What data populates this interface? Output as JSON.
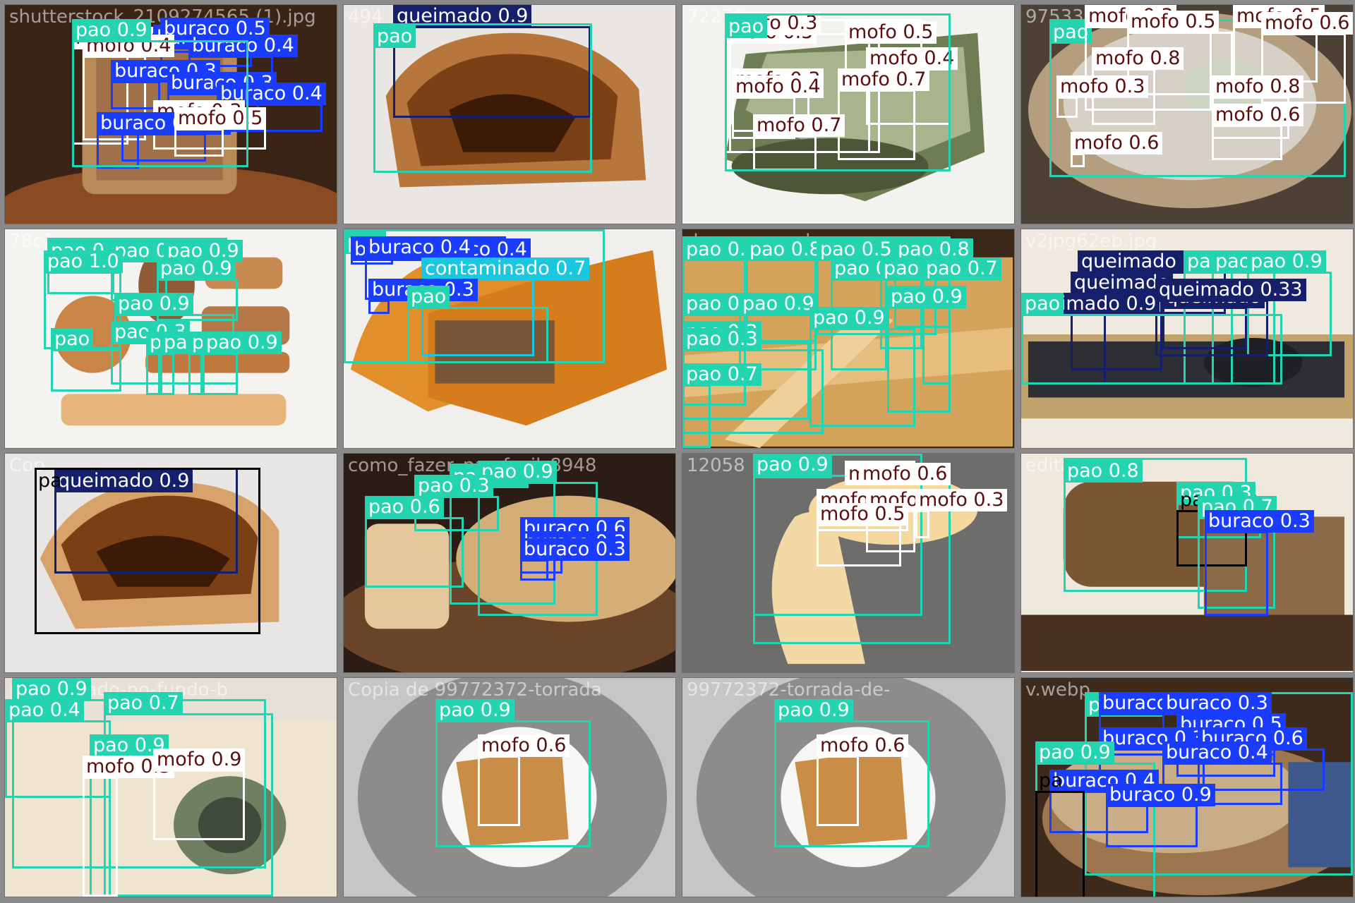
{
  "title": "",
  "classes": {
    "pao": "#24d4b0",
    "mofo": "#ffffff",
    "buraco": "#1a3cff",
    "queimado": "#16206a",
    "contaminado": "#19c8e0"
  },
  "tiles": [
    {
      "name": "shutterstock_2109274565 (1).jpg",
      "filename": "shutterstock_2109274565 (1).jpg",
      "detections": [
        {
          "label": "mofo 0.4"
        },
        {
          "label": "buraco 0.4"
        },
        {
          "label": "buraco 0.5"
        },
        {
          "label": "mofo 0.4"
        },
        {
          "label": "buraco 0.4"
        },
        {
          "label": "buraco 0.3"
        },
        {
          "label": "buraco 0.3"
        },
        {
          "label": "buraco 0.4"
        },
        {
          "label": "mofo 0.3"
        },
        {
          "label": "buraco 0.3"
        },
        {
          "label": "buraco 0.4"
        },
        {
          "label": "mofo 0.5"
        },
        {
          "label": "pao 0.9"
        }
      ]
    },
    {
      "name": "494...",
      "filename": "494",
      "detections": [
        {
          "label": "queimado 0.9"
        },
        {
          "label": "pao"
        }
      ]
    },
    {
      "name": "72276...",
      "filename": "72276",
      "detections": [
        {
          "label": "mofo 0.5"
        },
        {
          "label": "mofo 0.3"
        },
        {
          "label": "mofo 0.5"
        },
        {
          "label": "mofo 0.4"
        },
        {
          "label": "mofo 0.3"
        },
        {
          "label": "mofo 0.4"
        },
        {
          "label": "mofo 0.7"
        },
        {
          "label": "mofo 0.7"
        },
        {
          "label": "pao"
        }
      ]
    },
    {
      "name": "9753309-...",
      "filename": "9753309-",
      "detections": [
        {
          "label": "pao"
        },
        {
          "label": "mofo 0.3"
        },
        {
          "label": "mofo 0.5"
        },
        {
          "label": "mofo 0.5"
        },
        {
          "label": "mofo 0.6"
        },
        {
          "label": "mofo 0.8"
        },
        {
          "label": "mofo 0.3"
        },
        {
          "label": "mofo 0.8"
        },
        {
          "label": "mofo 0.6"
        },
        {
          "label": "mofo 0.6"
        }
      ]
    },
    {
      "name": "78c1...",
      "filename": "78c1",
      "detections": [
        {
          "label": "pao 0.9"
        },
        {
          "label": "pao 0.9"
        },
        {
          "label": "pao 0.9"
        },
        {
          "label": "pao 1.0"
        },
        {
          "label": "pao 0.9"
        },
        {
          "label": "pao 0.9"
        },
        {
          "label": "pao 0.3"
        },
        {
          "label": "pao"
        },
        {
          "label": "pao 0.5"
        },
        {
          "label": "pao 0.6"
        },
        {
          "label": "pao 0.7"
        },
        {
          "label": "pao 0.9"
        }
      ]
    },
    {
      "name": "...jpg",
      "filename": "jpg",
      "detections": [
        {
          "label": "pao"
        },
        {
          "label": "buraco 0.4"
        },
        {
          "label": "buraco 0.4"
        },
        {
          "label": "buraco 0.4"
        },
        {
          "label": "contaminado 0.7"
        },
        {
          "label": "buraco 0.3"
        },
        {
          "label": "pao"
        }
      ]
    },
    {
      "name": "...de-marco-e-d...a-do-pao...",
      "filename": "de-marco-e-d",
      "detections": [
        {
          "label": "pao 0.5"
        },
        {
          "label": "pao 0.8"
        },
        {
          "label": "pao 0.5"
        },
        {
          "label": "pao 0.8"
        },
        {
          "label": "pao 0.3"
        },
        {
          "label": "pao 0.4"
        },
        {
          "label": "pao"
        },
        {
          "label": "pao 0.7"
        },
        {
          "label": "pao 0.6"
        },
        {
          "label": "pao 0.9"
        },
        {
          "label": "pao 0.9"
        },
        {
          "label": "pao 0.9"
        },
        {
          "label": "pao 0.3"
        },
        {
          "label": "pao 0.7"
        }
      ]
    },
    {
      "name": "...v2jpg62eb.jpg",
      "filename": "v2jpg62eb.jpg",
      "detections": [
        {
          "label": "queimado 0.9"
        },
        {
          "label": "pao 0.8"
        },
        {
          "label": "pao 0.9"
        },
        {
          "label": "pao 0.9"
        },
        {
          "label": "queimado"
        },
        {
          "label": "queimado"
        },
        {
          "label": "queimado 0.33"
        },
        {
          "label": "queimado 0.9"
        },
        {
          "label": "pao"
        }
      ]
    },
    {
      "name": "Cop...pao-quei...",
      "filename": "Cop",
      "detections": [
        {
          "label": "queimado 0.9"
        },
        {
          "label": "pa"
        }
      ]
    },
    {
      "name": "como_fazer_pao...facil_8948...",
      "filename": "como_fazer_pao facil_8948",
      "detections": [
        {
          "label": "pao 0.8"
        },
        {
          "label": "pao 0.9"
        },
        {
          "label": "pao 0.3"
        },
        {
          "label": "pao 0.6"
        },
        {
          "label": "buraco 0.6"
        },
        {
          "label": "buraco 0.3"
        },
        {
          "label": "buraco 0.3"
        }
      ]
    },
    {
      "name": "...12058...pao-int...",
      "filename": "12058",
      "detections": [
        {
          "label": "pao 0.9"
        },
        {
          "label": "pao 0.9"
        },
        {
          "label": "mofo 0.7"
        },
        {
          "label": "mofo 0.6"
        },
        {
          "label": "mofo"
        },
        {
          "label": "mofo 0.3"
        },
        {
          "label": "mofo 0.3"
        },
        {
          "label": "mofo 0.5"
        }
      ]
    },
    {
      "name": "...editado.w...",
      "filename": "editado.w",
      "detections": [
        {
          "label": "pao 0.8"
        },
        {
          "label": "pao 0.3"
        },
        {
          "label": "pa"
        },
        {
          "label": "pao 0.7"
        },
        {
          "label": "buraco 0.3"
        }
      ]
    },
    {
      "name": "...-pao-mofado-no-fundo-b...",
      "filename": "pao-mofado-no-fundo-b",
      "detections": [
        {
          "label": "pao 0.9"
        },
        {
          "label": "pao 0.4"
        },
        {
          "label": "pao 0.7"
        },
        {
          "label": "pao 0.9"
        },
        {
          "label": "mofo 0.3"
        },
        {
          "label": "mofo 0.9"
        }
      ]
    },
    {
      "name": "Copia de 99772372-torrada...",
      "filename": "Copia de 99772372-torrada",
      "detections": [
        {
          "label": "pao 0.9"
        },
        {
          "label": "mofo 0.6"
        }
      ]
    },
    {
      "name": "99772372-torrada-de-...",
      "filename": "99772372-torrada-de-",
      "detections": [
        {
          "label": "pao 0.9"
        },
        {
          "label": "mofo 0.6"
        }
      ]
    },
    {
      "name": "...segundo...v.webp",
      "filename": "v.webp",
      "detections": [
        {
          "label": "pao 0.9"
        },
        {
          "label": "buraco"
        },
        {
          "label": "buraco 0.3"
        },
        {
          "label": "buraco 0.5"
        },
        {
          "label": "buraco 0.3"
        },
        {
          "label": "buraco 0.6"
        },
        {
          "label": "buraco 0.4"
        },
        {
          "label": "pao 0.9"
        },
        {
          "label": "buraco 0.4"
        },
        {
          "label": "buraco 0.9"
        },
        {
          "label": "pa"
        }
      ]
    }
  ]
}
